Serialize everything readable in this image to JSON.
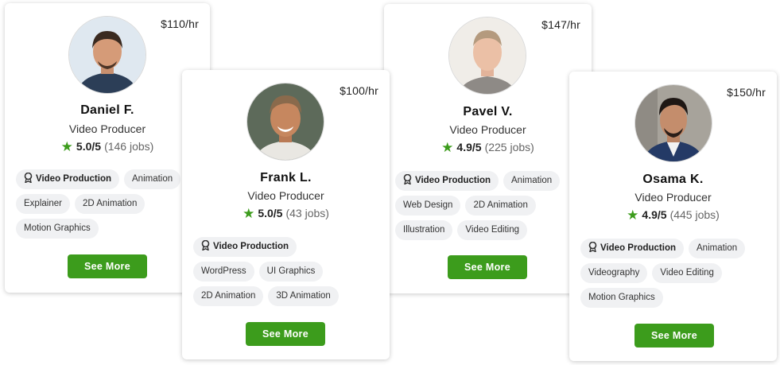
{
  "cards": [
    {
      "rate": "$110/hr",
      "name": "Daniel F.",
      "title": "Video Producer",
      "score": "5.0/5",
      "jobs": "(146 jobs)",
      "top_skill": "Video Production",
      "skill_rows": [
        [
          "Animation"
        ],
        [
          "Explainer",
          "2D Animation"
        ],
        [
          "Motion Graphics"
        ]
      ],
      "button": "See More"
    },
    {
      "rate": "$100/hr",
      "name": "Frank L.",
      "title": "Video Producer",
      "score": "5.0/5",
      "jobs": "(43 jobs)",
      "top_skill": "Video Production",
      "skill_rows": [
        [],
        [
          "WordPress",
          "UI Graphics"
        ],
        [
          "2D Animation",
          "3D Animation"
        ]
      ],
      "button": "See More"
    },
    {
      "rate": "$147/hr",
      "name": "Pavel V.",
      "title": "Video Producer",
      "score": "4.9/5",
      "jobs": "(225 jobs)",
      "top_skill": "Video Production",
      "skill_rows": [
        [
          "Animation"
        ],
        [
          "Web Design",
          "2D Animation"
        ],
        [
          "Illustration",
          "Video Editing"
        ]
      ],
      "button": "See More"
    },
    {
      "rate": "$150/hr",
      "name": "Osama K.",
      "title": "Video Producer",
      "score": "4.9/5",
      "jobs": "(445 jobs)",
      "top_skill": "Video Production",
      "skill_rows": [
        [
          "Animation"
        ],
        [
          "Videography",
          "Video Editing"
        ],
        [
          "Motion Graphics"
        ]
      ],
      "button": "See More"
    }
  ],
  "colors": {
    "accent": "#3c9c1c",
    "chip_bg": "#f0f1f3"
  },
  "icons": {
    "star": "star-icon",
    "badge": "top-rated-badge-icon"
  }
}
